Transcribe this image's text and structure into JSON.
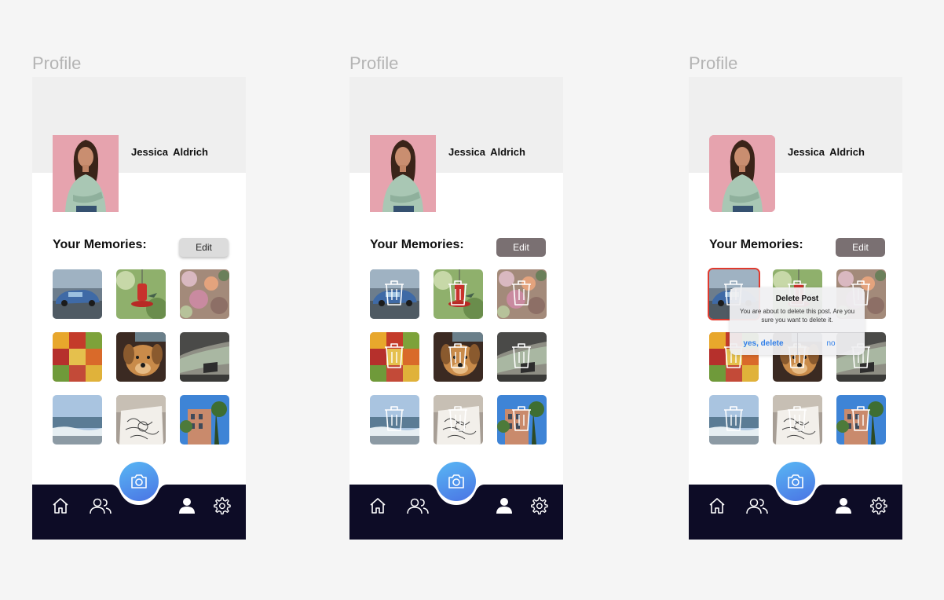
{
  "screens": [
    {
      "label": "Profile",
      "user": "Jessica  Aldrich",
      "memories_title": "Your Memories:",
      "edit_label": "Edit"
    },
    {
      "label": "Profile",
      "user": "Jessica  Aldrich",
      "memories_title": "Your Memories:",
      "edit_label": "Edit"
    },
    {
      "label": "Profile",
      "user": "Jessica  Aldrich",
      "memories_title": "Your Memories:",
      "edit_label": "Edit"
    }
  ],
  "dialog": {
    "title": "Delete Post",
    "message": "You are about to delete this post. Are you sure you want to delete it.",
    "confirm": "yes, delete",
    "cancel": "no"
  },
  "memories": [
    "car",
    "hummingbird-feeder",
    "flowers",
    "market-produce",
    "dog",
    "car-window",
    "ocean",
    "sketchbook",
    "building"
  ],
  "icons": {
    "nav": [
      "home-icon",
      "friends-icon",
      "camera-icon",
      "profile-icon",
      "settings-icon"
    ],
    "overlay": "trash-icon"
  },
  "colors": {
    "nav_bar": "#0d0c26",
    "camera_gradient_start": "#59b7f4",
    "camera_gradient_end": "#4a74e4",
    "edit_active": "#7a7072",
    "selected_border": "#e03a2e",
    "dialog_link": "#2f7ee8"
  }
}
